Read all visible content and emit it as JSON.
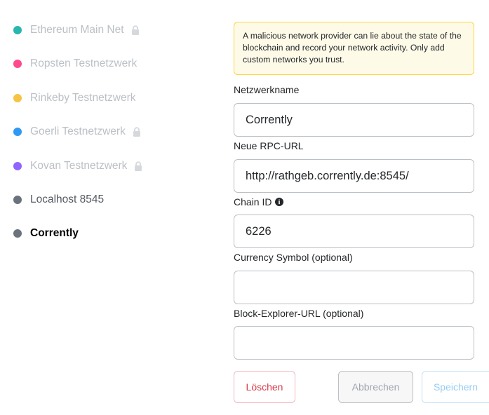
{
  "colors": {
    "ethereum": "#29b6af",
    "ropsten": "#ff4a8d",
    "rinkeby": "#f6c343",
    "goerli": "#3099f2",
    "kovan": "#9064ff",
    "custom": "#6a737d"
  },
  "networks": [
    {
      "label": "Ethereum Main Net",
      "locked": true,
      "icon": "lock-icon"
    },
    {
      "label": "Ropsten Testnetzwerk",
      "locked": false
    },
    {
      "label": "Rinkeby Testnetzwerk",
      "locked": false
    },
    {
      "label": "Goerli Testnetzwerk",
      "locked": true,
      "icon": "lock-icon"
    },
    {
      "label": "Kovan Testnetzwerk",
      "locked": true,
      "icon": "lock-icon"
    },
    {
      "label": "Localhost 8545",
      "locked": false
    },
    {
      "label": "Corrently",
      "locked": false,
      "selected": true
    }
  ],
  "warning": {
    "text": "A malicious network provider can lie about the state of the blockchain and record your network activity. Only add custom networks you trust."
  },
  "form": {
    "network_name": {
      "label": "Netzwerkname",
      "value": "Corrently"
    },
    "rpc_url": {
      "label": "Neue RPC-URL",
      "value": "http://rathgeb.corrently.de:8545/"
    },
    "chain_id": {
      "label": "Chain ID",
      "value": "6226",
      "icon": "info-icon"
    },
    "currency_symbol": {
      "label": "Currency Symbol (optional)",
      "value": ""
    },
    "block_explorer": {
      "label": "Block-Explorer-URL (optional)",
      "value": ""
    }
  },
  "buttons": {
    "delete": "Löschen",
    "cancel": "Abbrechen",
    "save": "Speichern"
  }
}
